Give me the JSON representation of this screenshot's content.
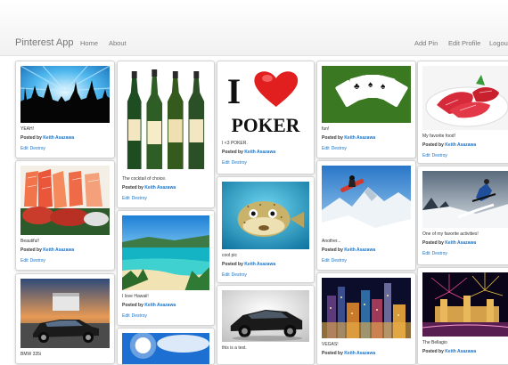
{
  "navbar": {
    "brand": "Pinterest App",
    "links_left": [
      "Home",
      "About"
    ],
    "links_right": [
      "Add Pin",
      "Edit Profile",
      "Logout"
    ]
  },
  "pin_labels": {
    "posted_by": "Posted by",
    "edit": "Edit",
    "destroy": "Destroy"
  },
  "pins": [
    {
      "caption": "YEAH!",
      "author": "Keith Asazawa",
      "image": "concert-crowd"
    },
    {
      "caption": "Beautiful!",
      "author": "Keith Asazawa",
      "image": "sashimi"
    },
    {
      "caption": "BMW 335i",
      "author": "",
      "image": "car-sunset"
    },
    {
      "caption": "The cocktail of choice.",
      "author": "Keith Asazawa",
      "image": "whiskey-bottles"
    },
    {
      "caption": "I love Hawaii!",
      "author": "Keith Asazawa",
      "image": "tropical-beach"
    },
    {
      "caption": "",
      "author": "",
      "image": "blue-sky-sun"
    },
    {
      "caption": "I <3 POKER.",
      "author": "Keith Asazawa",
      "image": "i-love-poker"
    },
    {
      "caption": "cool pic",
      "author": "Keith Asazawa",
      "image": "pufferfish"
    },
    {
      "caption": "this is a test.",
      "author": "",
      "image": "sports-car"
    },
    {
      "caption": "fun!",
      "author": "Keith Asazawa",
      "image": "playing-cards"
    },
    {
      "caption": "Another...",
      "author": "Keith Asazawa",
      "image": "snowboarder"
    },
    {
      "caption": "VEGAS!",
      "author": "Keith Asazawa",
      "image": "vegas-night"
    },
    {
      "caption": "My favorite food!",
      "author": "Keith Asazawa",
      "image": "salmon-sashimi"
    },
    {
      "caption": "One of my favorite activities!",
      "author": "Keith Asazawa",
      "image": "skier"
    },
    {
      "caption": "The Bellagio",
      "author": "Keith Asazawa",
      "image": "bellagio-fireworks"
    }
  ],
  "poker_text": {
    "letter": "I",
    "word": "POKER"
  },
  "colors": {
    "link": "#1a73c9",
    "nav_text": "#777777",
    "border": "#d4d4d4"
  }
}
